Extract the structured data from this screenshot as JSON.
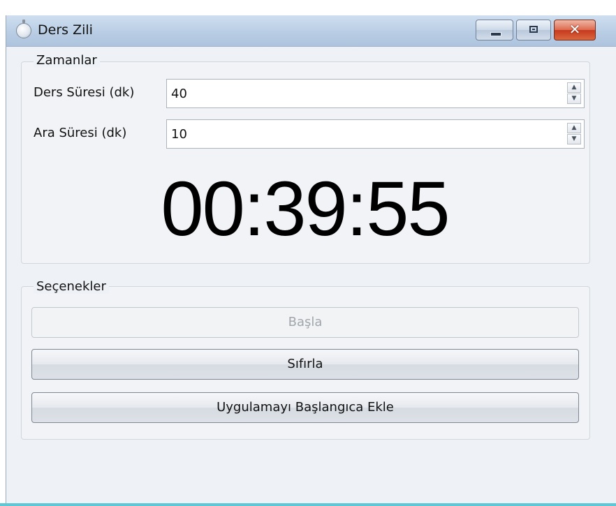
{
  "window": {
    "title": "Ders Zili",
    "accent_color": "#c7391d",
    "app_icon": "stopwatch-icon"
  },
  "caption_buttons": {
    "close_symbol": "✕",
    "minimize_icon": "minimize-icon",
    "maximize_icon": "maximize-icon",
    "close_icon": "close-icon"
  },
  "zamanlar": {
    "legend": "Zamanlar",
    "ders_suresi": {
      "label": "Ders Süresi (dk)",
      "value": "40"
    },
    "ara_suresi": {
      "label": "Ara Süresi (dk)",
      "value": "10"
    },
    "spin_up": "▲",
    "spin_down": "▼",
    "timer": "00:39:55"
  },
  "secenekler": {
    "legend": "Seçenekler",
    "basla": "Başla",
    "sifirla": "Sıfırla",
    "ekle": "Uygulamayı Başlangıca Ekle"
  }
}
